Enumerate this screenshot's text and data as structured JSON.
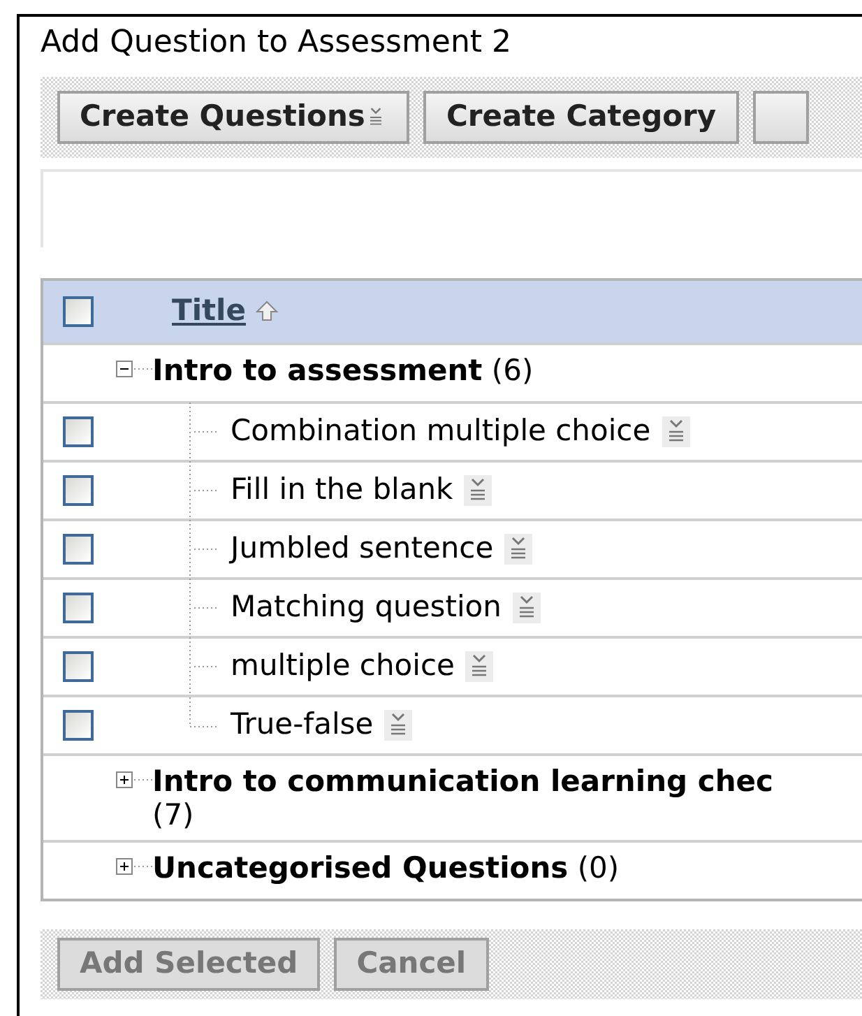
{
  "dialog": {
    "title": "Add Question to Assessment 2"
  },
  "toolbar": [
    {
      "label": "Create Questions",
      "menu": true
    },
    {
      "label": "Create Category",
      "menu": false
    },
    {
      "menu": false
    }
  ],
  "table": {
    "select_all": {
      "checked": false
    },
    "column": {
      "label": "Title",
      "sort_ascending": true
    },
    "categories": [
      {
        "title": "Intro to assessment",
        "count": "(6)",
        "expanded": true,
        "children": [
          {
            "title": "Combination multiple choice",
            "checked": false
          },
          {
            "title": "Fill in the blank",
            "checked": false
          },
          {
            "title": "Jumbled sentence",
            "checked": false
          },
          {
            "title": "Matching question",
            "checked": false
          },
          {
            "title": "multiple choice",
            "checked": false
          },
          {
            "title": "True-false",
            "checked": false
          }
        ]
      },
      {
        "title": "Intro to communication learning chec",
        "count": "(7)",
        "expanded": false
      },
      {
        "title": "Uncategorised Questions",
        "count": "(0)",
        "expanded": false
      }
    ]
  },
  "footer": [
    {
      "label": "Add Selected",
      "disabled": true
    },
    {
      "label": "Cancel",
      "disabled": true
    }
  ]
}
